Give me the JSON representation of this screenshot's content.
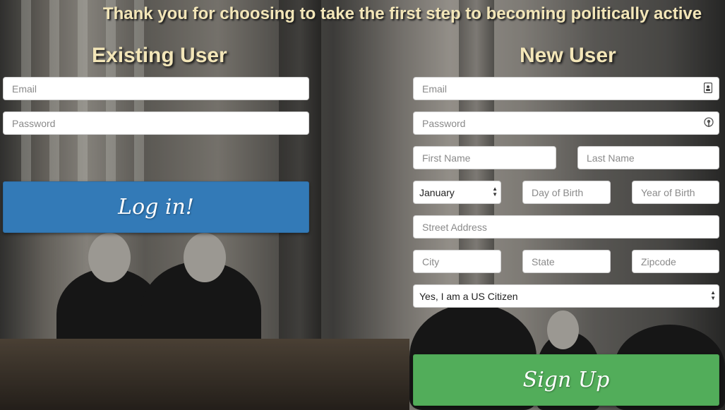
{
  "headline": "Thank you for choosing to take the first step to becoming politically active",
  "existing_user": {
    "title": "Existing User",
    "email_placeholder": "Email",
    "password_placeholder": "Password",
    "login_label": "Log in!"
  },
  "new_user": {
    "title": "New User",
    "email_placeholder": "Email",
    "password_placeholder": "Password",
    "first_name_placeholder": "First Name",
    "last_name_placeholder": "Last Name",
    "month_selected": "January",
    "day_placeholder": "Day of Birth",
    "year_placeholder": "Year of Birth",
    "street_placeholder": "Street Address",
    "city_placeholder": "City",
    "state_placeholder": "State",
    "zip_placeholder": "Zipcode",
    "citizen_selected": "Yes, I am a US Citizen",
    "signup_label": "Sign Up",
    "email_icon": "contact-card-icon",
    "password_icon": "key-icon"
  },
  "colors": {
    "title_text": "#f3e6b8",
    "login_button": "#337ab7",
    "signup_button": "#52ad5a"
  }
}
